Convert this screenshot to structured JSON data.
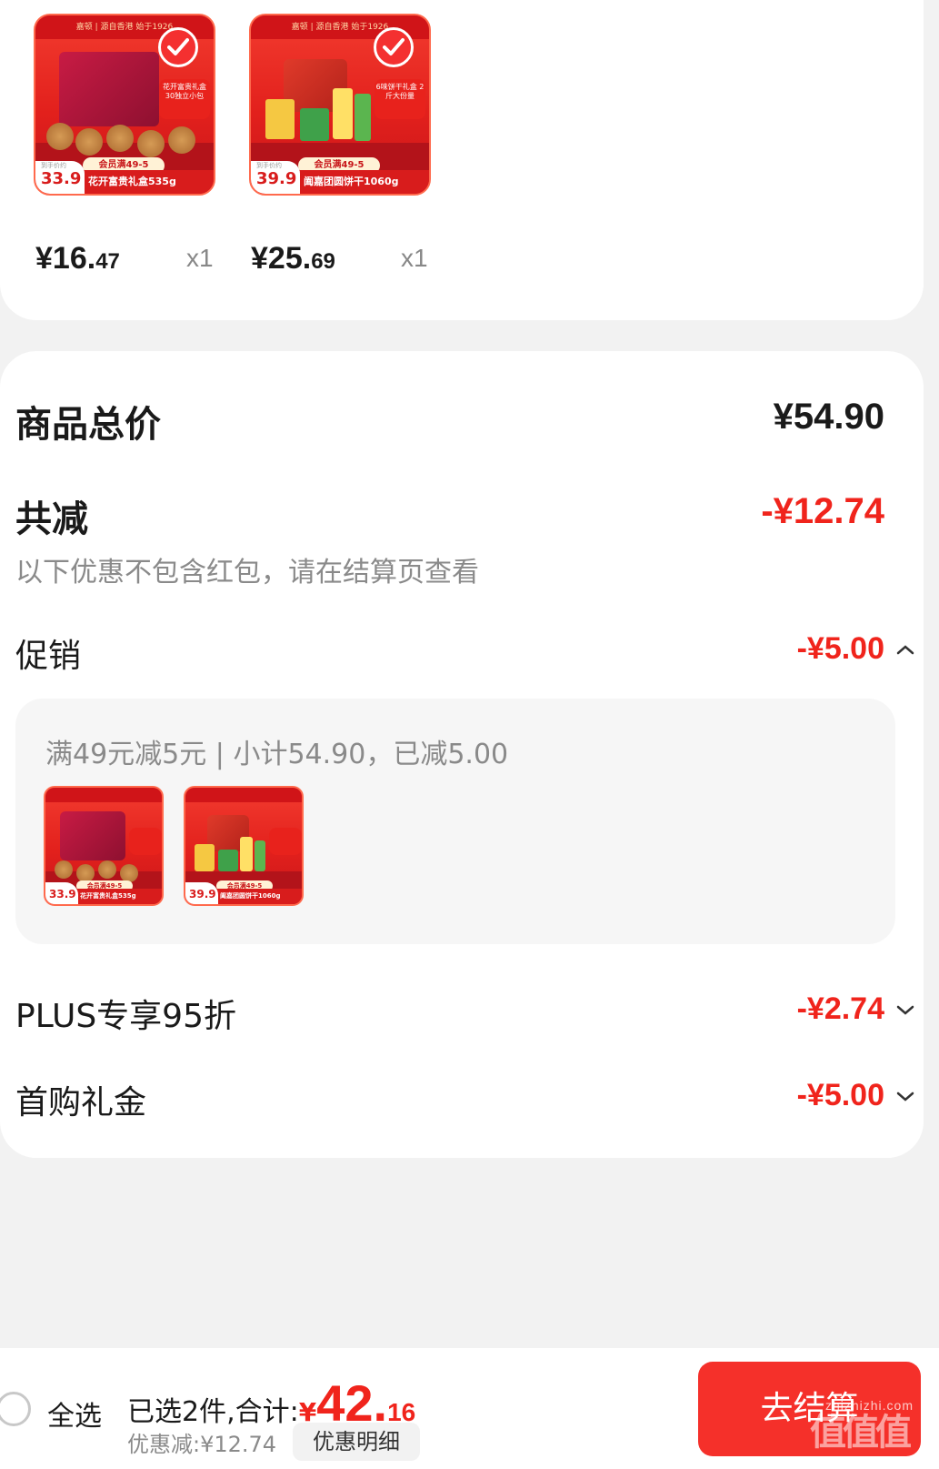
{
  "products": [
    {
      "name": "花开富贵礼盒535g",
      "promo": "会员满49-5",
      "badge_price": "33.9",
      "badge_note": "到手价约",
      "side_note": "花开富贵礼盒 30独立小包",
      "brand_bar": "嘉顿 | 源自香港 始于1926",
      "price_int": "¥16.",
      "price_dec": "47",
      "qty": "x1"
    },
    {
      "name": "阖嘉团圆饼干1060g",
      "promo": "会员满49-5",
      "badge_price": "39.9",
      "badge_note": "到手价约",
      "side_note": "6味饼干礼盒 2斤大份量",
      "brand_bar": "嘉顿 | 源自香港 始于1926",
      "price_int": "¥25.",
      "price_dec": "69",
      "qty": "x1"
    }
  ],
  "summary": {
    "total_label": "商品总价",
    "total_value": "¥54.90",
    "reduce_label": "共减",
    "reduce_value": "-¥12.74",
    "reduce_note": "以下优惠不包含红包，请在结算页查看",
    "promo_label": "促销",
    "promo_value": "-¥5.00",
    "promo_desc": "满49元减5元 | 小计54.90，已减5.00",
    "plus_label": "PLUS专享95折",
    "plus_value": "-¥2.74",
    "first_label": "首购礼金",
    "first_value": "-¥5.00"
  },
  "bottom": {
    "select_all": "全选",
    "selected_text": "已选2件,合计:",
    "currency": "¥",
    "total_int": "42.",
    "total_dec": "16",
    "discount_text": "优惠减:¥12.74",
    "detail_btn": "优惠明细",
    "checkout_btn": "去结算",
    "watermark": "zhizhizhi.com",
    "watermark_logo": "值值值"
  },
  "colors": {
    "accent_red": "#f0241c",
    "button_red": "#f5302a",
    "card_bg": "#ffffff",
    "page_bg": "#f2f2f2"
  }
}
